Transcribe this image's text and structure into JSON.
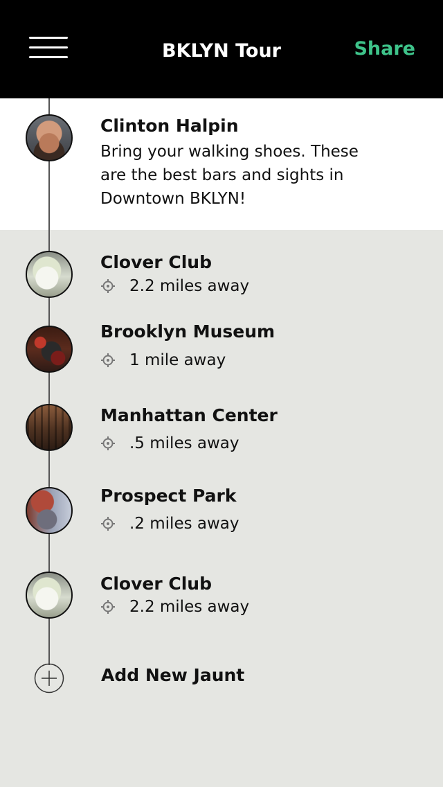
{
  "header": {
    "title": "BKLYN Tour",
    "share_label": "Share",
    "menu_icon": "hamburger-menu-icon",
    "background_color": "#000000",
    "share_color": "#3ec38a"
  },
  "intro": {
    "author_name": "Clinton Halpin",
    "description": "Bring your walking shoes. These are the best bars and sights in Downtown BKLYN!"
  },
  "places": [
    {
      "name": "Clover Club",
      "distance": "2.2 miles away"
    },
    {
      "name": "Brooklyn Museum",
      "distance": "1 mile away"
    },
    {
      "name": "Manhattan Center",
      "distance": ".5 miles away"
    },
    {
      "name": "Prospect Park",
      "distance": ".2 miles away"
    },
    {
      "name": "Clover Club",
      "distance": "2.2 miles away"
    }
  ],
  "add_new": {
    "label": "Add New Jaunt",
    "icon": "plus-circle-icon"
  },
  "colors": {
    "list_background": "#e5e6e2",
    "intro_background": "#ffffff"
  }
}
